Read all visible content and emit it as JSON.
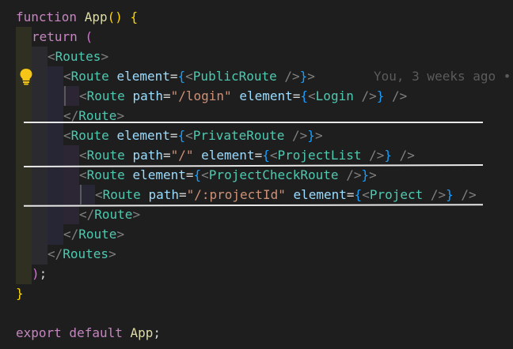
{
  "editor": {
    "blame_text": "You, 3 weeks ago •",
    "lines": [
      {
        "tokens": [
          [
            "tok-kw",
            "function "
          ],
          [
            "tok-fn",
            "App"
          ],
          [
            "tok-brace",
            "()"
          ],
          [
            "tok-plain",
            " "
          ],
          [
            "tok-brace",
            "{"
          ]
        ]
      },
      {
        "tokens": [
          [
            "tok-kw",
            "return "
          ],
          [
            "tok-brace2",
            "("
          ]
        ]
      },
      {
        "tokens": [
          [
            "tok-lt",
            "<"
          ],
          [
            "tok-tag",
            "Routes"
          ],
          [
            "tok-lt",
            ">"
          ]
        ]
      },
      {
        "tokens": [
          [
            "tok-lt",
            "<"
          ],
          [
            "tok-tag",
            "Route "
          ],
          [
            "tok-attr",
            "element"
          ],
          [
            "tok-eq",
            "="
          ],
          [
            "tok-brace3",
            "{"
          ],
          [
            "tok-lt",
            "<"
          ],
          [
            "tok-tag",
            "PublicRoute "
          ],
          [
            "tok-lt",
            "/>"
          ],
          [
            "tok-brace3",
            "}"
          ],
          [
            "tok-lt",
            ">"
          ]
        ]
      },
      {
        "tokens": [
          [
            "tok-lt",
            "<"
          ],
          [
            "tok-tag",
            "Route "
          ],
          [
            "tok-attr",
            "path"
          ],
          [
            "tok-eq",
            "="
          ],
          [
            "tok-str",
            "\"/login\" "
          ],
          [
            "tok-attr",
            "element"
          ],
          [
            "tok-eq",
            "="
          ],
          [
            "tok-brace3",
            "{"
          ],
          [
            "tok-lt",
            "<"
          ],
          [
            "tok-tag",
            "Login "
          ],
          [
            "tok-lt",
            "/>"
          ],
          [
            "tok-brace3",
            "} "
          ],
          [
            "tok-lt",
            "/>"
          ]
        ]
      },
      {
        "tokens": [
          [
            "tok-lt",
            "</"
          ],
          [
            "tok-tag",
            "Route"
          ],
          [
            "tok-lt",
            ">"
          ]
        ]
      },
      {
        "tokens": [
          [
            "tok-lt",
            "<"
          ],
          [
            "tok-tag",
            "Route "
          ],
          [
            "tok-attr",
            "element"
          ],
          [
            "tok-eq",
            "="
          ],
          [
            "tok-brace3",
            "{"
          ],
          [
            "tok-lt",
            "<"
          ],
          [
            "tok-tag",
            "PrivateRoute "
          ],
          [
            "tok-lt",
            "/>"
          ],
          [
            "tok-brace3",
            "}"
          ],
          [
            "tok-lt",
            ">"
          ]
        ]
      },
      {
        "tokens": [
          [
            "tok-lt",
            "<"
          ],
          [
            "tok-tag",
            "Route "
          ],
          [
            "tok-attr",
            "path"
          ],
          [
            "tok-eq",
            "="
          ],
          [
            "tok-str",
            "\"/\" "
          ],
          [
            "tok-attr",
            "element"
          ],
          [
            "tok-eq",
            "="
          ],
          [
            "tok-brace3",
            "{"
          ],
          [
            "tok-lt",
            "<"
          ],
          [
            "tok-tag",
            "ProjectList "
          ],
          [
            "tok-lt",
            "/>"
          ],
          [
            "tok-brace3",
            "} "
          ],
          [
            "tok-lt",
            "/>"
          ]
        ]
      },
      {
        "tokens": [
          [
            "tok-lt",
            "<"
          ],
          [
            "tok-tag",
            "Route "
          ],
          [
            "tok-attr",
            "element"
          ],
          [
            "tok-eq",
            "="
          ],
          [
            "tok-brace3",
            "{"
          ],
          [
            "tok-lt",
            "<"
          ],
          [
            "tok-tag",
            "ProjectCheckRoute "
          ],
          [
            "tok-lt",
            "/>"
          ],
          [
            "tok-brace3",
            "}"
          ],
          [
            "tok-lt",
            ">"
          ]
        ]
      },
      {
        "tokens": [
          [
            "tok-lt",
            "<"
          ],
          [
            "tok-tag",
            "Route "
          ],
          [
            "tok-attr",
            "path"
          ],
          [
            "tok-eq",
            "="
          ],
          [
            "tok-str",
            "\"/:projectId\" "
          ],
          [
            "tok-attr",
            "element"
          ],
          [
            "tok-eq",
            "="
          ],
          [
            "tok-brace3",
            "{"
          ],
          [
            "tok-lt",
            "<"
          ],
          [
            "tok-tag",
            "Project "
          ],
          [
            "tok-lt",
            "/>"
          ],
          [
            "tok-brace3",
            "} "
          ],
          [
            "tok-lt",
            "/>"
          ]
        ]
      },
      {
        "tokens": [
          [
            "tok-lt",
            "</"
          ],
          [
            "tok-tag",
            "Route"
          ],
          [
            "tok-lt",
            ">"
          ]
        ]
      },
      {
        "tokens": [
          [
            "tok-lt",
            "</"
          ],
          [
            "tok-tag",
            "Route"
          ],
          [
            "tok-lt",
            ">"
          ]
        ]
      },
      {
        "tokens": [
          [
            "tok-lt",
            "</"
          ],
          [
            "tok-tag",
            "Routes"
          ],
          [
            "tok-lt",
            ">"
          ]
        ]
      },
      {
        "tokens": [
          [
            "tok-brace2",
            ")"
          ],
          [
            "tok-plain",
            ";"
          ]
        ]
      },
      {
        "tokens": [
          [
            "tok-brace",
            "}"
          ]
        ]
      },
      {
        "tokens": []
      },
      {
        "tokens": [
          [
            "tok-kw",
            "export default "
          ],
          [
            "tok-fn",
            "App"
          ],
          [
            "tok-plain",
            ";"
          ]
        ]
      }
    ]
  },
  "icons": {
    "lightbulb": "lightbulb-icon"
  },
  "colors": {
    "background": "#1e1e1e",
    "keyword": "#c586c0",
    "tag": "#4ec9b0",
    "attribute": "#9cdcfe",
    "string": "#ce9178",
    "bulb": "#f5c518"
  }
}
